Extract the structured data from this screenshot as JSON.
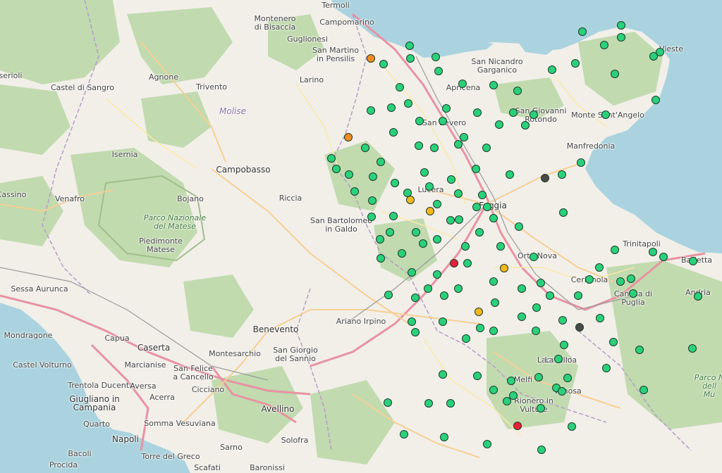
{
  "map": {
    "colors": {
      "land": "#f2efe9",
      "sea": "#aad3df",
      "forest": "#b9d7a5",
      "park_outline": "#9fbf8a",
      "motorway": "#e892a2",
      "primary": "#f6cf94",
      "secondary": "#fbe9a8",
      "admin": "#b79cc7",
      "rail": "#9a9a9a"
    },
    "marker_colors": {
      "green": "#2ad17a",
      "orange": "#f28c1e",
      "yellow": "#f2b81c",
      "red": "#e8203a",
      "gray": "#4a4a4a"
    },
    "place_labels": [
      {
        "id": "termoli",
        "text": "Termoli",
        "kind": "town"
      },
      {
        "id": "campomarino",
        "text": "Campomarino",
        "kind": "town"
      },
      {
        "id": "montenero",
        "text": "Montenero\ndi Bisaccia",
        "kind": "town"
      },
      {
        "id": "guglionesi",
        "text": "Guglionesi",
        "kind": "town"
      },
      {
        "id": "san-martino",
        "text": "San Martino\nin Pensilis",
        "kind": "town"
      },
      {
        "id": "san-nicandro",
        "text": "San Nicandro\nGarganico",
        "kind": "town"
      },
      {
        "id": "vieste",
        "text": "Vieste",
        "kind": "town"
      },
      {
        "id": "apricena",
        "text": "Apricena",
        "kind": "town"
      },
      {
        "id": "san-giovanni",
        "text": "San Giovanni\nRotondo",
        "kind": "town"
      },
      {
        "id": "monte-santangelo",
        "text": "Monte Sant'Angelo",
        "kind": "town"
      },
      {
        "id": "san-severo",
        "text": "San Severo",
        "kind": "town"
      },
      {
        "id": "manfredonia",
        "text": "Manfredonia",
        "kind": "town"
      },
      {
        "id": "isernia",
        "text": "Isernia",
        "kind": "town"
      },
      {
        "id": "larino",
        "text": "Larino",
        "kind": "town"
      },
      {
        "id": "agnone",
        "text": "Agnone",
        "kind": "town"
      },
      {
        "id": "trivento",
        "text": "Trivento",
        "kind": "town"
      },
      {
        "id": "castel-di-sangro",
        "text": "Castel di Sangro",
        "kind": "town"
      },
      {
        "id": "serioli",
        "text": "serioli",
        "kind": "town"
      },
      {
        "id": "molise",
        "text": "Molise",
        "kind": "region"
      },
      {
        "id": "campobasso",
        "text": "Campobasso",
        "kind": "city"
      },
      {
        "id": "venafro",
        "text": "Venafro",
        "kind": "town"
      },
      {
        "id": "bojano",
        "text": "Bojano",
        "kind": "town"
      },
      {
        "id": "riccia",
        "text": "Riccia",
        "kind": "town"
      },
      {
        "id": "cassino",
        "text": "Cassino",
        "kind": "town"
      },
      {
        "id": "lucera",
        "text": "Lucera",
        "kind": "town"
      },
      {
        "id": "foggia",
        "text": "Foggia",
        "kind": "city"
      },
      {
        "id": "parco-matese",
        "text": "Parco Nazionale\ndel Matese",
        "kind": "park"
      },
      {
        "id": "piedimonte",
        "text": "Piedimonte\nMatese",
        "kind": "town"
      },
      {
        "id": "san-bartolomeo",
        "text": "San Bartolomeo\nin Galdo",
        "kind": "town"
      },
      {
        "id": "trinitapoli",
        "text": "Trinitapoli",
        "kind": "town"
      },
      {
        "id": "orta-nova",
        "text": "Orta Nova",
        "kind": "town"
      },
      {
        "id": "barletta",
        "text": "Barletta",
        "kind": "town"
      },
      {
        "id": "cerignola",
        "text": "Cerignola",
        "kind": "town"
      },
      {
        "id": "andria",
        "text": "Andria",
        "kind": "town"
      },
      {
        "id": "canosa",
        "text": "Canosa di\nPuglia",
        "kind": "town"
      },
      {
        "id": "sessa-aurunca",
        "text": "Sessa Aurunca",
        "kind": "town"
      },
      {
        "id": "benevento",
        "text": "Benevento",
        "kind": "city"
      },
      {
        "id": "ariano-irpino",
        "text": "Ariano Irpino",
        "kind": "town"
      },
      {
        "id": "mondragone",
        "text": "Mondragone",
        "kind": "town"
      },
      {
        "id": "capua",
        "text": "Capua",
        "kind": "town"
      },
      {
        "id": "caserta",
        "text": "Caserta",
        "kind": "city"
      },
      {
        "id": "montesarchio",
        "text": "Montesarchio",
        "kind": "town"
      },
      {
        "id": "san-giorgio",
        "text": "San Giorgio\ndel Sannio",
        "kind": "town"
      },
      {
        "id": "castel-volturno",
        "text": "Castel Volturno",
        "kind": "town"
      },
      {
        "id": "marcianise",
        "text": "Marcianise",
        "kind": "town"
      },
      {
        "id": "san-felice",
        "text": "San Felice\na Cancello",
        "kind": "town"
      },
      {
        "id": "trentola",
        "text": "Trentola Ducenta",
        "kind": "town"
      },
      {
        "id": "aversa",
        "text": "Aversa",
        "kind": "town"
      },
      {
        "id": "cicciano",
        "text": "Cicciano",
        "kind": "town"
      },
      {
        "id": "giugliano",
        "text": "Giugliano in\nCampania",
        "kind": "city"
      },
      {
        "id": "acerra",
        "text": "Acerra",
        "kind": "town"
      },
      {
        "id": "avellino",
        "text": "Avellino",
        "kind": "city"
      },
      {
        "id": "lacedonia",
        "text": "Lacedonia",
        "kind": "town"
      },
      {
        "id": "melfi",
        "text": "Melfi",
        "kind": "town"
      },
      {
        "id": "rionero",
        "text": "Rionero in\nVulture",
        "kind": "town"
      },
      {
        "id": "lavello",
        "text": "Lavello",
        "kind": "town"
      },
      {
        "id": "venosa",
        "text": "Venosa",
        "kind": "town"
      },
      {
        "id": "parco-murgia",
        "text": "Parco N\ndell\nMu",
        "kind": "park"
      },
      {
        "id": "quarto",
        "text": "Quarto",
        "kind": "town"
      },
      {
        "id": "napoli",
        "text": "Napoli",
        "kind": "city"
      },
      {
        "id": "somma",
        "text": "Somma Vesuviana",
        "kind": "town"
      },
      {
        "id": "bacoli",
        "text": "Bacoli",
        "kind": "town"
      },
      {
        "id": "torre-del-greco",
        "text": "Torre del Greco",
        "kind": "town"
      },
      {
        "id": "sarno",
        "text": "Sarno",
        "kind": "town"
      },
      {
        "id": "solofra",
        "text": "Solofra",
        "kind": "town"
      },
      {
        "id": "procida",
        "text": "Procida",
        "kind": "town"
      },
      {
        "id": "scafati",
        "text": "Scafati",
        "kind": "town"
      },
      {
        "id": "baronissi",
        "text": "Baronissi",
        "kind": "town"
      }
    ],
    "stations": [
      {
        "status": "orange"
      },
      {
        "status": "orange"
      },
      {
        "status": "yellow"
      },
      {
        "status": "yellow"
      },
      {
        "status": "yellow"
      },
      {
        "status": "yellow"
      },
      {
        "status": "red"
      },
      {
        "status": "red"
      },
      {
        "status": "gray"
      },
      {
        "status": "gray"
      },
      {
        "status": "green"
      },
      {
        "status": "green"
      },
      {
        "status": "green"
      },
      {
        "status": "green"
      },
      {
        "status": "green"
      },
      {
        "status": "green"
      },
      {
        "status": "green"
      },
      {
        "status": "green"
      },
      {
        "status": "green"
      },
      {
        "status": "green"
      },
      {
        "status": "green"
      },
      {
        "status": "green"
      },
      {
        "status": "green"
      },
      {
        "status": "green"
      },
      {
        "status": "green"
      },
      {
        "status": "green"
      },
      {
        "status": "green"
      },
      {
        "status": "green"
      },
      {
        "status": "green"
      },
      {
        "status": "green"
      },
      {
        "status": "green"
      },
      {
        "status": "green"
      },
      {
        "status": "green"
      },
      {
        "status": "green"
      },
      {
        "status": "green"
      },
      {
        "status": "green"
      },
      {
        "status": "green"
      },
      {
        "status": "green"
      },
      {
        "status": "green"
      },
      {
        "status": "green"
      },
      {
        "status": "green"
      },
      {
        "status": "green"
      },
      {
        "status": "green"
      },
      {
        "status": "green"
      },
      {
        "status": "green"
      },
      {
        "status": "green"
      },
      {
        "status": "green"
      },
      {
        "status": "green"
      },
      {
        "status": "green"
      },
      {
        "status": "green"
      },
      {
        "status": "green"
      },
      {
        "status": "green"
      },
      {
        "status": "green"
      },
      {
        "status": "green"
      },
      {
        "status": "green"
      },
      {
        "status": "green"
      },
      {
        "status": "green"
      },
      {
        "status": "green"
      },
      {
        "status": "green"
      },
      {
        "status": "green"
      },
      {
        "status": "green"
      },
      {
        "status": "green"
      },
      {
        "status": "green"
      },
      {
        "status": "green"
      },
      {
        "status": "green"
      },
      {
        "status": "green"
      },
      {
        "status": "green"
      },
      {
        "status": "green"
      },
      {
        "status": "green"
      },
      {
        "status": "green"
      },
      {
        "status": "green"
      },
      {
        "status": "green"
      },
      {
        "status": "green"
      },
      {
        "status": "green"
      },
      {
        "status": "green"
      },
      {
        "status": "green"
      },
      {
        "status": "green"
      },
      {
        "status": "green"
      },
      {
        "status": "green"
      },
      {
        "status": "green"
      },
      {
        "status": "green"
      },
      {
        "status": "green"
      },
      {
        "status": "green"
      },
      {
        "status": "green"
      },
      {
        "status": "green"
      },
      {
        "status": "green"
      },
      {
        "status": "green"
      },
      {
        "status": "green"
      },
      {
        "status": "green"
      },
      {
        "status": "green"
      },
      {
        "status": "green"
      },
      {
        "status": "green"
      },
      {
        "status": "green"
      },
      {
        "status": "green"
      },
      {
        "status": "green"
      },
      {
        "status": "green"
      },
      {
        "status": "green"
      },
      {
        "status": "green"
      },
      {
        "status": "green"
      },
      {
        "status": "green"
      },
      {
        "status": "green"
      },
      {
        "status": "green"
      },
      {
        "status": "green"
      },
      {
        "status": "green"
      },
      {
        "status": "green"
      },
      {
        "status": "green"
      },
      {
        "status": "green"
      },
      {
        "status": "green"
      },
      {
        "status": "green"
      },
      {
        "status": "green"
      },
      {
        "status": "green"
      },
      {
        "status": "green"
      },
      {
        "status": "green"
      },
      {
        "status": "green"
      },
      {
        "status": "green"
      },
      {
        "status": "green"
      },
      {
        "status": "green"
      },
      {
        "status": "green"
      },
      {
        "status": "green"
      },
      {
        "status": "green"
      },
      {
        "status": "green"
      },
      {
        "status": "green"
      },
      {
        "status": "green"
      },
      {
        "status": "green"
      },
      {
        "status": "green"
      },
      {
        "status": "green"
      },
      {
        "status": "green"
      },
      {
        "status": "green"
      },
      {
        "status": "green"
      },
      {
        "status": "green"
      },
      {
        "status": "green"
      },
      {
        "status": "green"
      },
      {
        "status": "green"
      },
      {
        "status": "green"
      },
      {
        "status": "green"
      },
      {
        "status": "green"
      },
      {
        "status": "green"
      },
      {
        "status": "green"
      },
      {
        "status": "green"
      },
      {
        "status": "green"
      },
      {
        "status": "green"
      },
      {
        "status": "green"
      },
      {
        "status": "green"
      },
      {
        "status": "green"
      },
      {
        "status": "green"
      },
      {
        "status": "green"
      },
      {
        "status": "green"
      },
      {
        "status": "green"
      }
    ]
  }
}
